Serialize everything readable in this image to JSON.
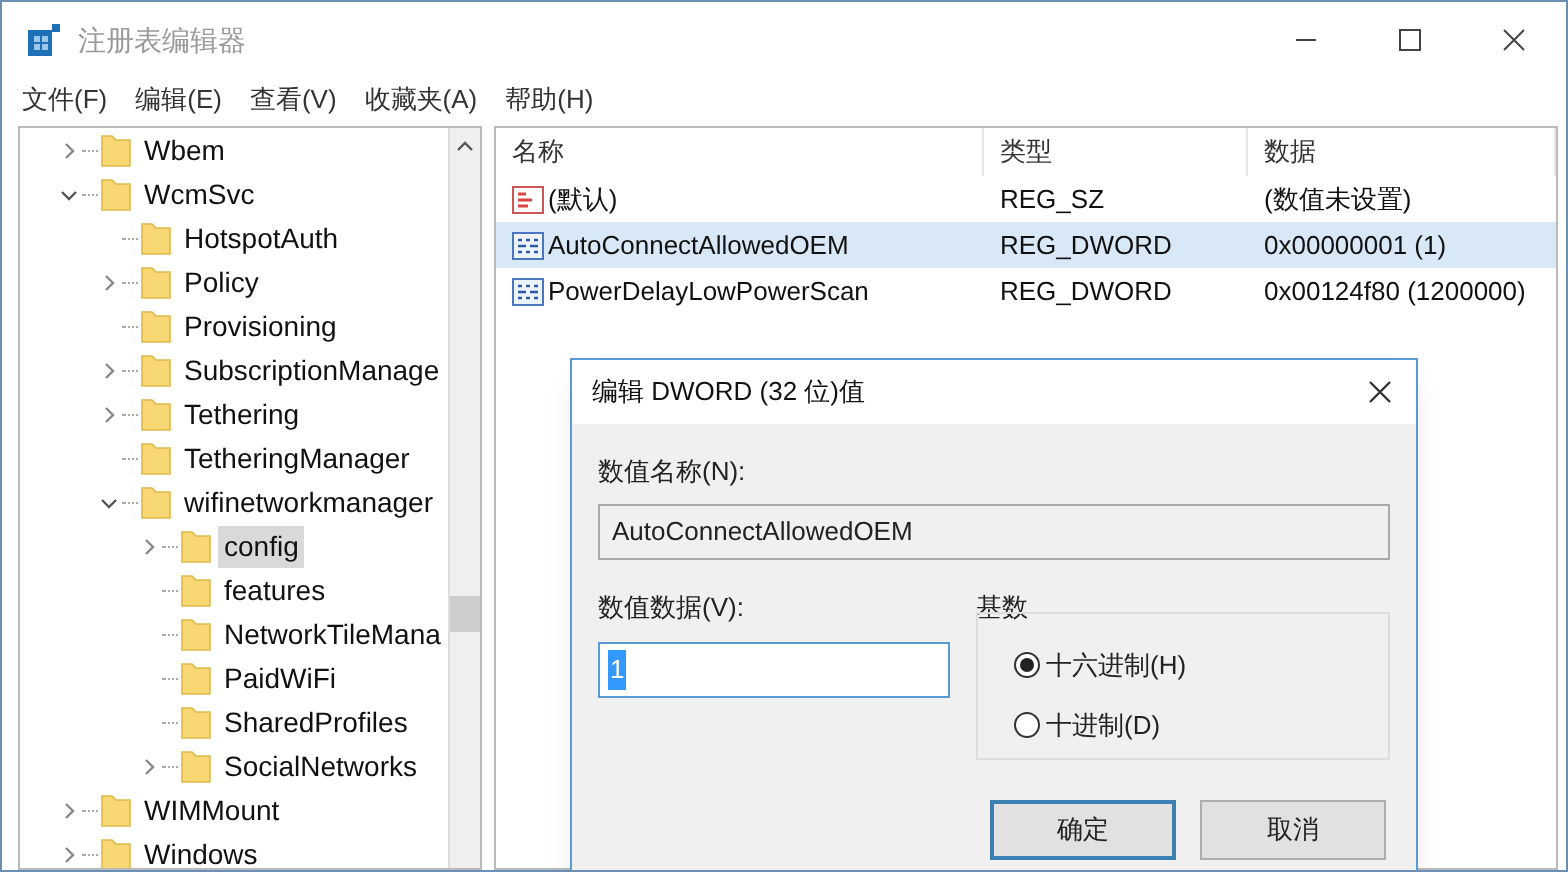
{
  "window": {
    "title": "注册表编辑器"
  },
  "menu": [
    "文件(F)",
    "编辑(E)",
    "查看(V)",
    "收藏夹(A)",
    "帮助(H)"
  ],
  "tree": [
    {
      "label": "Wbem",
      "expanded": false,
      "selected": false
    },
    {
      "label": "WcmSvc",
      "expanded": true,
      "selected": false,
      "children": [
        {
          "label": "HotspotAuth",
          "selected": false
        },
        {
          "label": "Policy",
          "expanded": false,
          "selected": false
        },
        {
          "label": "Provisioning",
          "selected": false
        },
        {
          "label": "SubscriptionManage",
          "expanded": false,
          "selected": false
        },
        {
          "label": "Tethering",
          "expanded": false,
          "selected": false
        },
        {
          "label": "TetheringManager",
          "selected": false
        },
        {
          "label": "wifinetworkmanager",
          "expanded": true,
          "selected": false,
          "children": [
            {
              "label": "config",
              "expanded": false,
              "selected": true
            },
            {
              "label": "features",
              "selected": false
            },
            {
              "label": "NetworkTileMana",
              "selected": false
            },
            {
              "label": "PaidWiFi",
              "selected": false
            },
            {
              "label": "SharedProfiles",
              "selected": false
            },
            {
              "label": "SocialNetworks",
              "expanded": false,
              "selected": false
            }
          ]
        }
      ]
    },
    {
      "label": "WIMMount",
      "expanded": false,
      "selected": false
    },
    {
      "label": "Windows",
      "expanded": false,
      "selected": false
    }
  ],
  "table": {
    "columns": [
      "名称",
      "类型",
      "数据"
    ],
    "rows": [
      {
        "kind": "string",
        "name": "(默认)",
        "type": "REG_SZ",
        "data": "(数值未设置)",
        "selected": false
      },
      {
        "kind": "dword",
        "name": "AutoConnectAllowedOEM",
        "type": "REG_DWORD",
        "data": "0x00000001 (1)",
        "selected": true
      },
      {
        "kind": "dword",
        "name": "PowerDelayLowPowerScan",
        "type": "REG_DWORD",
        "data": "0x00124f80 (1200000)",
        "selected": false
      }
    ]
  },
  "dialog": {
    "title": "编辑 DWORD (32 位)值",
    "name_label": "数值名称(N):",
    "name_value": "AutoConnectAllowedOEM",
    "data_label": "数值数据(V):",
    "data_value": "1",
    "base": {
      "title": "基数",
      "options": [
        {
          "label": "十六进制(H)",
          "selected": true
        },
        {
          "label": "十进制(D)",
          "selected": false
        }
      ]
    },
    "buttons": [
      {
        "label": "确定",
        "default": true
      },
      {
        "label": "取消",
        "default": false
      }
    ]
  }
}
